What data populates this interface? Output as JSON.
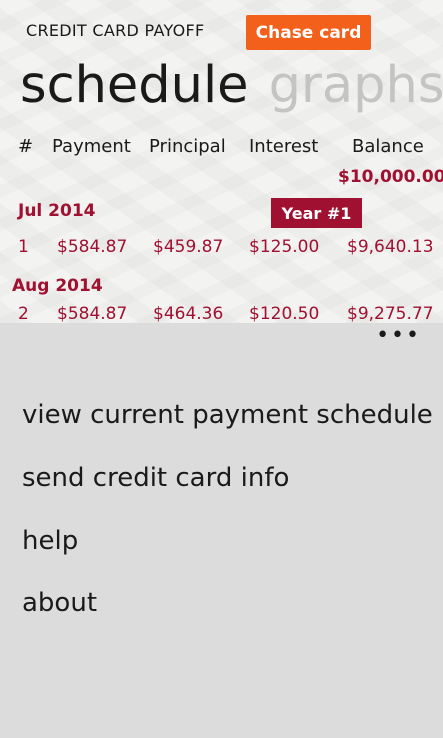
{
  "app": {
    "title": "CREDIT CARD PAYOFF",
    "promo_label": "Chase card"
  },
  "pivot": {
    "active": "schedule",
    "next": "graphs",
    "partial": "p"
  },
  "table": {
    "headers": [
      "#",
      "Payment",
      "Principal",
      "Interest",
      "Balance"
    ],
    "starting_balance": "$10,000.00",
    "year_badge": "Year #1",
    "months": [
      {
        "label": "Jul 2014",
        "row": [
          "1",
          "$584.87",
          "$459.87",
          "$125.00",
          "$9,640.13"
        ]
      },
      {
        "label": "Aug 2014",
        "row": [
          "2",
          "$584.87",
          "$464.36",
          "$120.50",
          "$9,275.77"
        ]
      }
    ]
  },
  "appbar": {
    "more": "•••",
    "menu": [
      "view current payment schedule",
      "send credit card info",
      "help",
      "about"
    ]
  },
  "colors": {
    "accent": "#a01030",
    "promo": "#f2601c"
  }
}
